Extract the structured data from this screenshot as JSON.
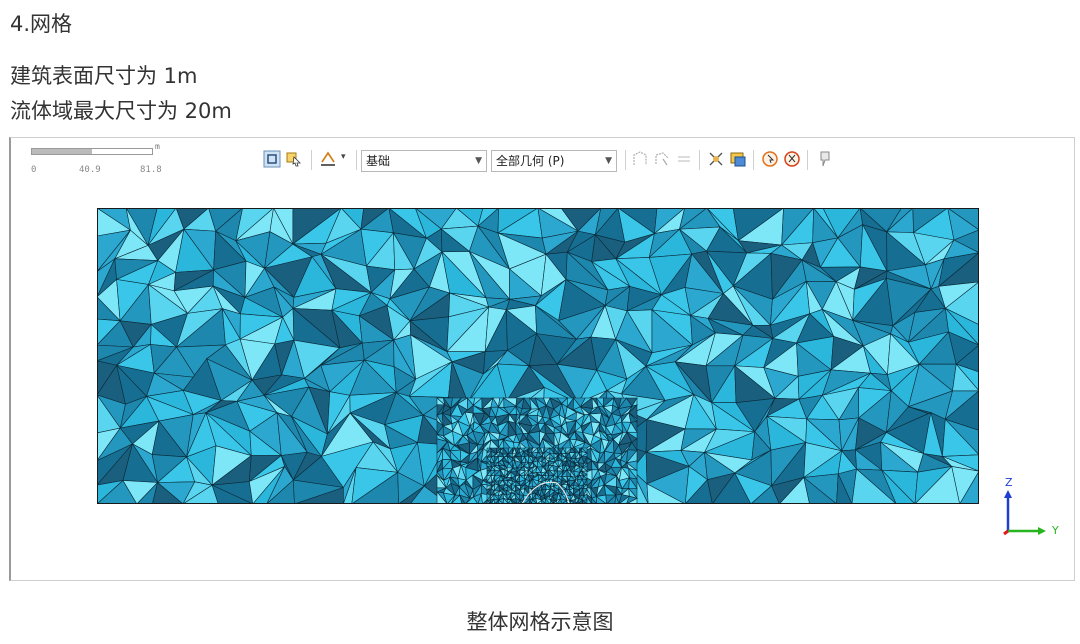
{
  "heading": "4.网格",
  "paragraph": {
    "line1": "建筑表面尺寸为 1m",
    "line2": "流体域最大尺寸为 20m"
  },
  "figure": {
    "scale_bar": {
      "unit": "m",
      "ticks": [
        "0",
        "40.9",
        "81.8"
      ]
    },
    "toolbar": {
      "combo_basic": "基础",
      "combo_geometry": "全部几何 (P)",
      "icons": [
        "select-face-icon",
        "select-mode-icon",
        "section-plane-icon",
        "wireframe-icon",
        "lasso-icon",
        "nodes-icon",
        "hide-icon",
        "show-icon",
        "probe-icon",
        "probe-alt-icon",
        "pin-icon"
      ]
    },
    "axes": {
      "z": "Z",
      "y": "Y"
    },
    "colors": {
      "mesh_dark": "#166f92",
      "mesh_mid": "#2bb6dc",
      "mesh_light": "#7ee7f7",
      "edge": "#0a2a38"
    }
  },
  "caption": "整体网格示意图"
}
